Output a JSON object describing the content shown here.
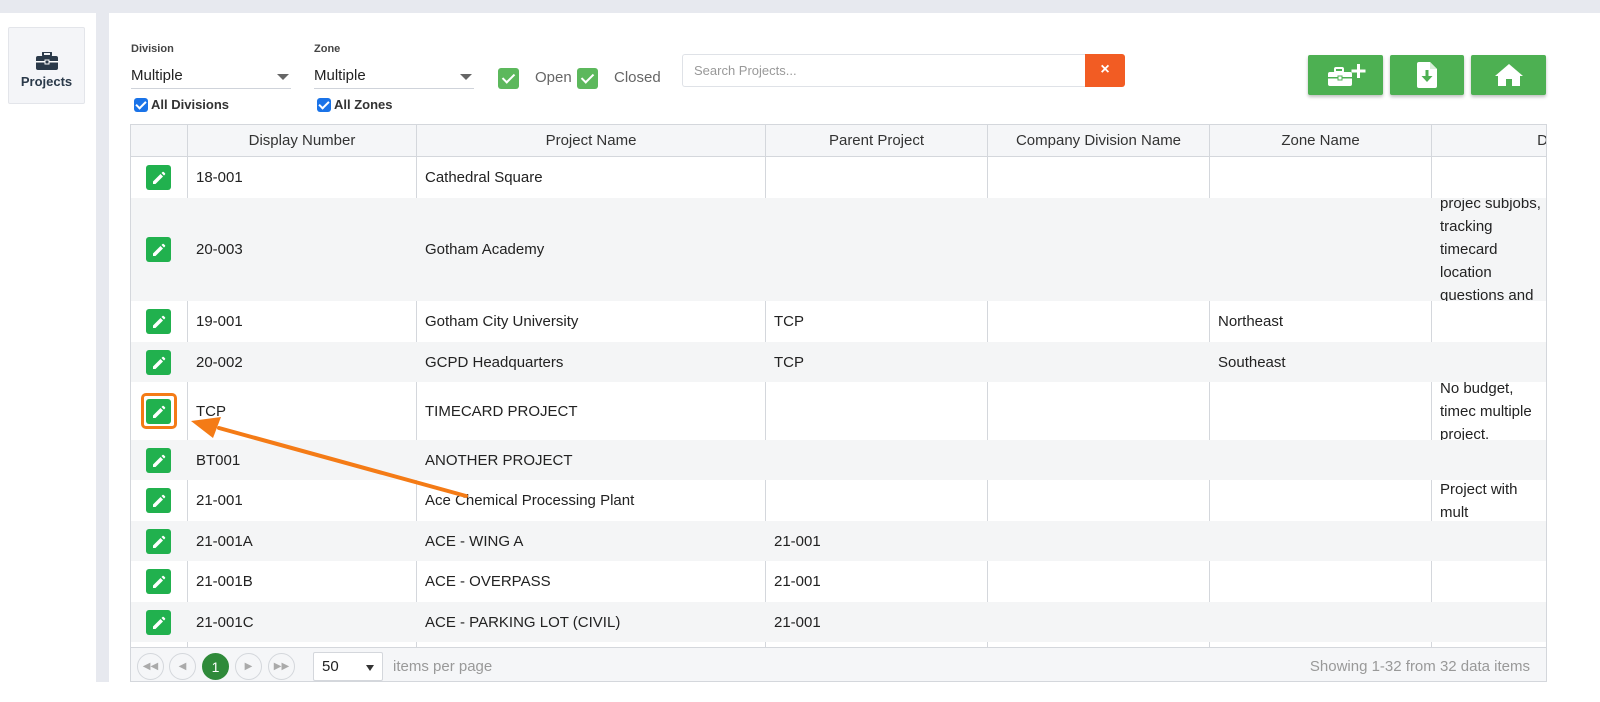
{
  "nav": {
    "projects_label": "Projects",
    "projects_icon": "briefcase-icon"
  },
  "filters": {
    "division_label": "Division",
    "division_value": "Multiple",
    "all_divisions_label": "All Divisions",
    "zone_label": "Zone",
    "zone_value": "Multiple",
    "all_zones_label": "All Zones",
    "open_label": "Open",
    "closed_label": "Closed",
    "search_placeholder": "Search Projects...",
    "clear_label": "×"
  },
  "toolbar": {
    "add_project_icon": "briefcase-plus-icon",
    "download_icon": "download-file-icon",
    "home_icon": "home-icon"
  },
  "grid": {
    "columns": [
      "Display Number",
      "Project Name",
      "Parent Project",
      "Company Division Name",
      "Zone Name",
      "D"
    ],
    "rows": [
      {
        "num": "18-001",
        "name": "Cathedral Square",
        "parent": "",
        "division": "",
        "zone": "",
        "desc": ""
      },
      {
        "num": "20-003",
        "name": "Gotham Academy",
        "parent": "",
        "division": "",
        "zone": "",
        "desc": "Advanced projec subjobs, tracking timecard location questions and sig"
      },
      {
        "num": "19-001",
        "name": "Gotham City University",
        "parent": "TCP",
        "division": "",
        "zone": "Northeast",
        "desc": ""
      },
      {
        "num": "20-002",
        "name": "GCPD Headquarters",
        "parent": "TCP",
        "division": "",
        "zone": "Southeast",
        "desc": ""
      },
      {
        "num": "TCP",
        "name": "TIMECARD PROJECT",
        "parent": "",
        "division": "",
        "zone": "",
        "desc": "No budget, timec multiple project."
      },
      {
        "num": "BT001",
        "name": "ANOTHER PROJECT",
        "parent": "",
        "division": "",
        "zone": "",
        "desc": ""
      },
      {
        "num": "21-001",
        "name": "Ace Chemical Processing Plant",
        "parent": "",
        "division": "",
        "zone": "",
        "desc": "Project with mult"
      },
      {
        "num": "21-001A",
        "name": "ACE - WING A",
        "parent": "21-001",
        "division": "",
        "zone": "",
        "desc": ""
      },
      {
        "num": "21-001B",
        "name": "ACE - OVERPASS",
        "parent": "21-001",
        "division": "",
        "zone": "",
        "desc": ""
      },
      {
        "num": "21-001C",
        "name": "ACE - PARKING LOT (CIVIL)",
        "parent": "21-001",
        "division": "",
        "zone": "",
        "desc": ""
      }
    ]
  },
  "pager": {
    "current_page": "1",
    "page_size": "50",
    "items_per_page_label": "items per page",
    "summary": "Showing 1-32 from 32 data items"
  },
  "colors": {
    "accent_green": "#4db052",
    "edit_green": "#21b14e",
    "clear_orange": "#f25c23",
    "highlight_orange": "#f47b16"
  }
}
